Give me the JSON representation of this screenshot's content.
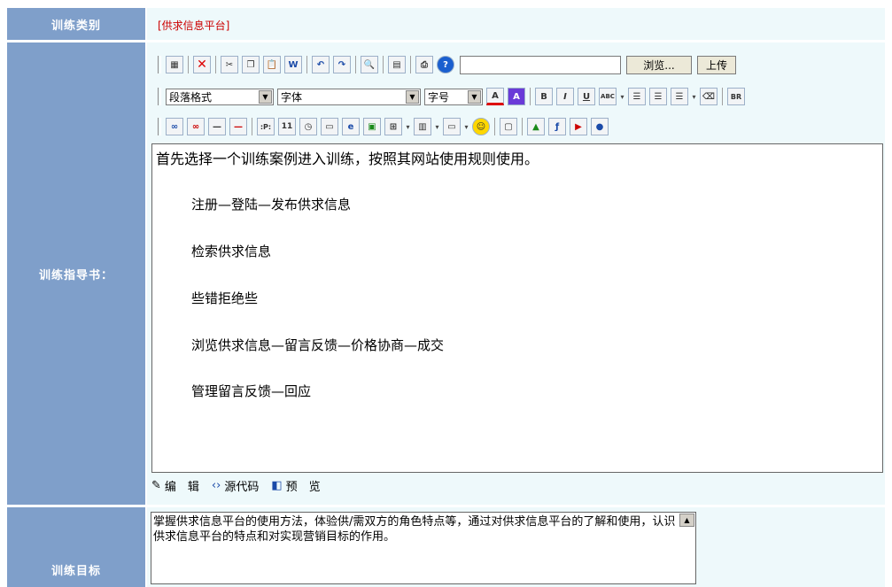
{
  "rows": {
    "category": {
      "label": "训练类别",
      "value": "[供求信息平台]"
    },
    "guide": {
      "label": "训练指导书："
    },
    "goal": {
      "label": "训练目标"
    }
  },
  "toolbar1": {
    "icons": [
      "select-all-icon",
      "delete-icon",
      "cut-icon",
      "copy-icon",
      "paste-icon",
      "paste-word-icon",
      "undo-icon",
      "redo-icon",
      "find-icon",
      "table-props-icon",
      "print-icon",
      "help-icon"
    ],
    "browse_label": "浏览...",
    "upload_label": "上传"
  },
  "toolbar2": {
    "paragraph_format": "段落格式",
    "font": "字体",
    "font_size": "字号"
  },
  "editor": {
    "lines": [
      "首先选择一个训练案例进入训练，按照其网站使用规则使用。",
      "注册—登陆—发布供求信息",
      "检索供求信息",
      "些错拒绝些",
      "浏览供求信息—留言反馈—价格协商—成交",
      "管理留言反馈—回应"
    ]
  },
  "modes": {
    "edit": "编　辑",
    "source": "源代码",
    "preview": "预　览"
  },
  "goal_text": "掌握供求信息平台的使用方法，体验供/需双方的角色特点等，通过对供求信息平台的了解和使用，认识供求信息平台的特点和对实现营销目标的作用。",
  "colors": {
    "label_bg": "#7f9fca",
    "value_bg": "#eef9fb",
    "category_text": "#cc0000"
  }
}
